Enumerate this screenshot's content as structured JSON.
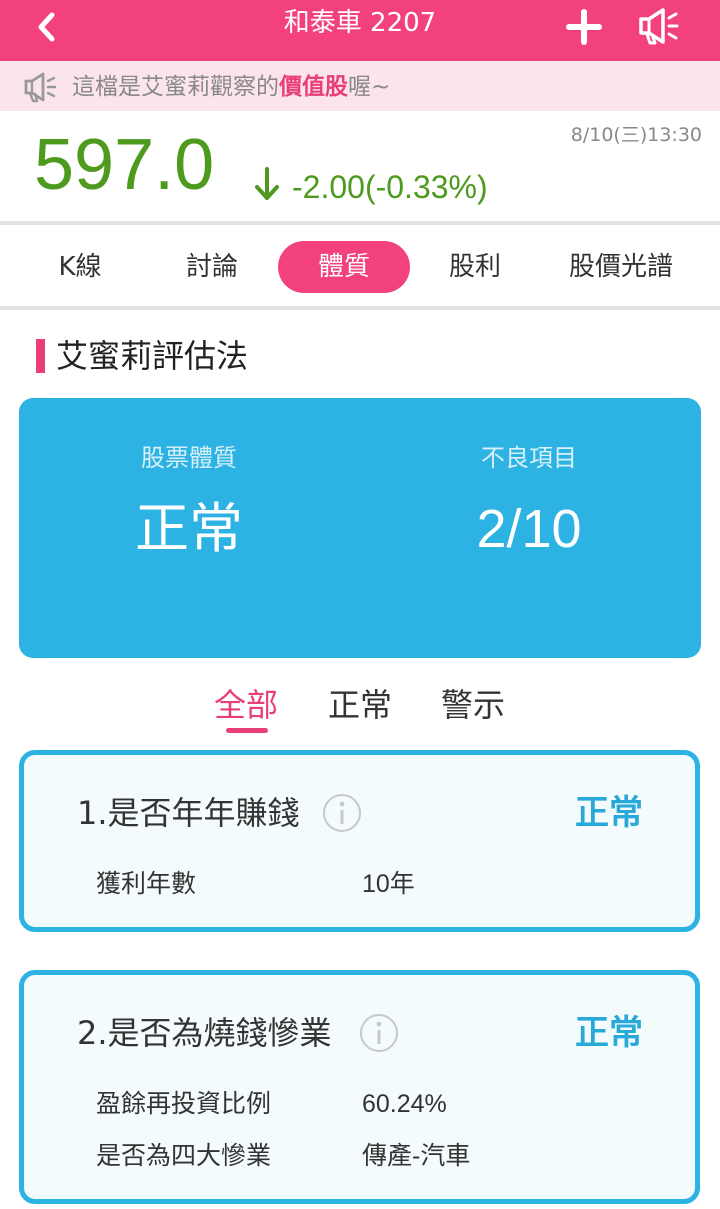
{
  "header": {
    "title": "和泰車 2207",
    "back_icon": "chevron-left-icon",
    "add_icon": "plus-icon",
    "notify_icon": "megaphone-icon",
    "bg_color": "#f2417e"
  },
  "notice": {
    "icon": "megaphone-icon",
    "prefix": "這檔是艾蜜莉觀察的",
    "highlight": "價值股",
    "suffix": "喔~"
  },
  "quote": {
    "price": "597.0",
    "direction": "down",
    "change": "-2.00(-0.33%)",
    "timestamp": "8/10(三)13:30",
    "color": "#4d9a1e"
  },
  "tabs": [
    {
      "label": "K線",
      "active": false
    },
    {
      "label": "討論",
      "active": false
    },
    {
      "label": "體質",
      "active": true
    },
    {
      "label": "股利",
      "active": false
    },
    {
      "label": "股價光譜",
      "active": false
    }
  ],
  "section_title": "艾蜜莉評估法",
  "summary": {
    "health_label": "股票體質",
    "health_value": "正常",
    "bad_label": "不良項目",
    "bad_value": "2/10"
  },
  "filters": [
    {
      "label": "全部",
      "active": true
    },
    {
      "label": "正常",
      "active": false
    },
    {
      "label": "警示",
      "active": false
    }
  ],
  "criteria": [
    {
      "title": "1.是否年年賺錢",
      "status": "正常",
      "rows": [
        {
          "label": "獲利年數",
          "value": "10年"
        }
      ]
    },
    {
      "title": "2.是否為燒錢慘業",
      "status": "正常",
      "rows": [
        {
          "label": "盈餘再投資比例",
          "value": "60.24%"
        },
        {
          "label": "是否為四大慘業",
          "value": "傳產-汽車"
        }
      ]
    }
  ]
}
